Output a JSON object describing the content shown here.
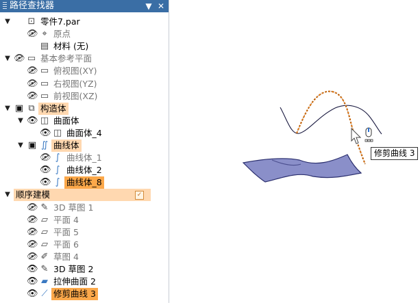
{
  "panel": {
    "title": "路径查找器",
    "pin_icon": "dropdown-triangle-icon",
    "close_icon": "close-icon"
  },
  "tree": [
    {
      "id": "root",
      "label": "零件7.par",
      "expander": "▼",
      "eye": null,
      "icon": "part-file-icon",
      "style": "normal"
    },
    {
      "id": "origin",
      "label": "原点",
      "expander": "",
      "eye": "hidden",
      "icon": "origin-axes-icon",
      "style": "gray"
    },
    {
      "id": "material",
      "label": "材料 (无)",
      "expander": "",
      "eye": null,
      "icon": "material-table-icon",
      "style": "normal"
    },
    {
      "id": "ref-planes",
      "label": "基本参考平面",
      "expander": "▼",
      "eye": "hidden",
      "icon": "plane-icon",
      "style": "gray"
    },
    {
      "id": "plane-xy",
      "label": "俯视图(XY)",
      "expander": "",
      "eye": "hidden",
      "icon": "plane-icon",
      "style": "gray"
    },
    {
      "id": "plane-yz",
      "label": "右视图(YZ)",
      "expander": "",
      "eye": "hidden",
      "icon": "plane-icon",
      "style": "gray"
    },
    {
      "id": "plane-xz",
      "label": "前视图(XZ)",
      "expander": "",
      "eye": "hidden",
      "icon": "plane-icon",
      "style": "gray"
    },
    {
      "id": "construction",
      "label": "构造体",
      "expander": "▼",
      "eye": "box",
      "icon": "construction-icon",
      "style": "hl"
    },
    {
      "id": "surfaces",
      "label": "曲面体",
      "expander": "▼",
      "eye": "visible",
      "icon": "surface-body-icon",
      "style": "normal"
    },
    {
      "id": "surface-4",
      "label": "曲面体_4",
      "expander": "",
      "eye": "visible",
      "icon": "surface-body-icon",
      "style": "normal"
    },
    {
      "id": "curves",
      "label": "曲线体",
      "expander": "▼",
      "eye": "box",
      "icon": "curve-body-icon",
      "style": "hl"
    },
    {
      "id": "curve-1",
      "label": "曲线体_1",
      "expander": "",
      "eye": "hidden",
      "icon": "curve-icon",
      "style": "gray"
    },
    {
      "id": "curve-2",
      "label": "曲线体_2",
      "expander": "",
      "eye": "visible",
      "icon": "curve-icon",
      "style": "normal"
    },
    {
      "id": "curve-8",
      "label": "曲线体_8",
      "expander": "",
      "eye": "visible",
      "icon": "curve-icon",
      "style": "hl2"
    },
    {
      "id": "ordered",
      "label": "顺序建模",
      "expander": "▼",
      "eye": null,
      "icon": null,
      "style": "hlwide"
    },
    {
      "id": "sketch3d-1",
      "label": "3D 草图 1",
      "expander": "",
      "eye": "hidden",
      "icon": "sketch-3d-icon",
      "style": "gray"
    },
    {
      "id": "plane-4",
      "label": "平面 4",
      "expander": "",
      "eye": "hidden",
      "icon": "plane-feature-icon",
      "style": "gray"
    },
    {
      "id": "plane-5",
      "label": "平面 5",
      "expander": "",
      "eye": "hidden",
      "icon": "plane-feature-icon",
      "style": "gray"
    },
    {
      "id": "plane-6",
      "label": "平面 6",
      "expander": "",
      "eye": "hidden",
      "icon": "plane-feature-icon",
      "style": "gray"
    },
    {
      "id": "sketch-4",
      "label": "草图 4",
      "expander": "",
      "eye": "hidden",
      "icon": "sketch-icon",
      "style": "gray"
    },
    {
      "id": "sketch3d-2",
      "label": "3D 草图 2",
      "expander": "",
      "eye": "visible",
      "icon": "sketch-3d-icon",
      "style": "normal"
    },
    {
      "id": "extrude-2",
      "label": "拉伸曲面 2",
      "expander": "",
      "eye": "visible",
      "icon": "extrude-surface-icon",
      "style": "normal"
    },
    {
      "id": "trim-3",
      "label": "修剪曲线 3",
      "expander": "",
      "eye": "visible",
      "icon": "trim-curve-icon",
      "style": "hl2"
    }
  ],
  "viewport": {
    "tooltip": "修剪曲线 3",
    "colors": {
      "highlight_curve": "#e07a1a",
      "surface": "#8a8fc9",
      "surface_edge": "#2b2f6e"
    }
  }
}
